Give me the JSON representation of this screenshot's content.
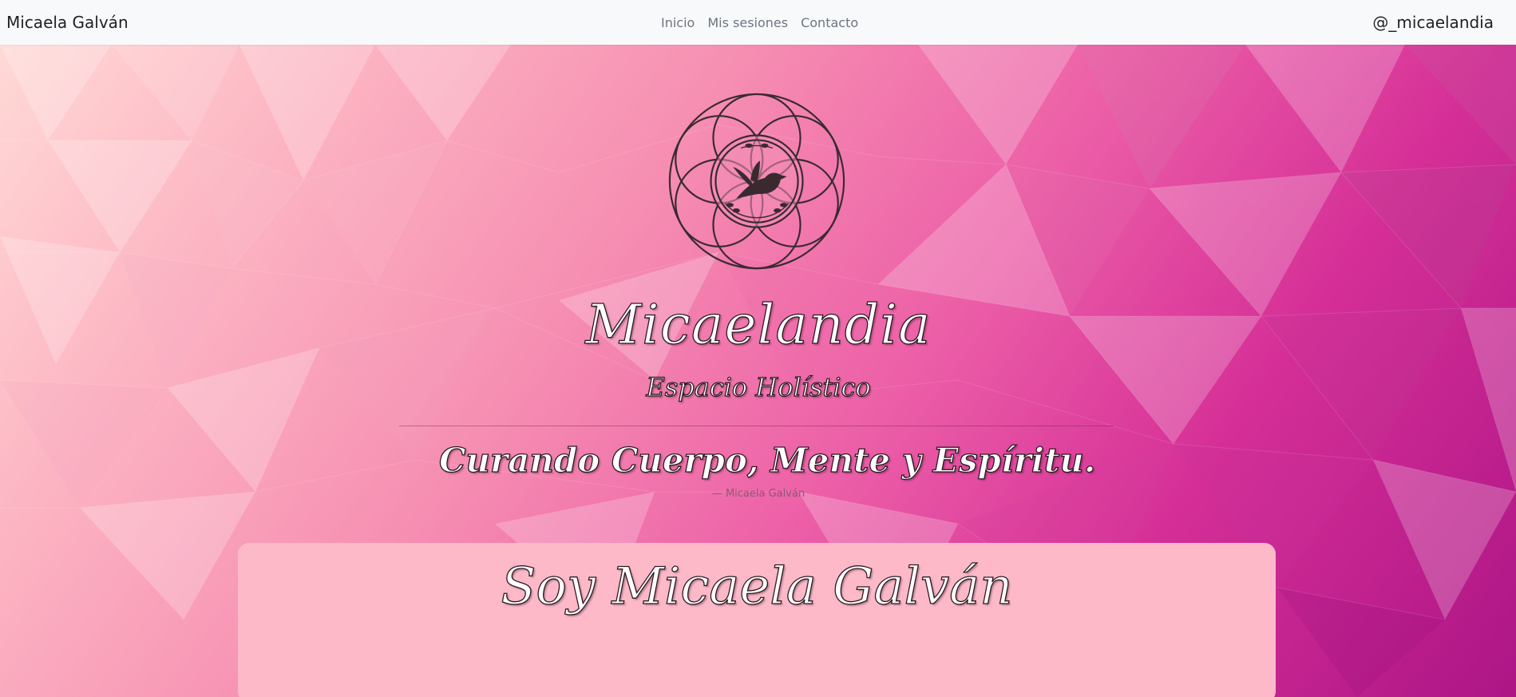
{
  "navbar": {
    "brand": "Micaela Galván",
    "links": [
      "Inicio",
      "Mis sesiones",
      "Contacto"
    ],
    "handle": "@_micaelandia"
  },
  "hero": {
    "title": "Micaelandia",
    "subtitle": "Espacio Holístico",
    "quote": "Curando Cuerpo, Mente y Espíritu.",
    "quote_author": "— Micaela Galván",
    "logo_icon": "flower-of-life-bird-icon"
  },
  "about_card": {
    "title": "Soy Micaela Galván"
  },
  "colors": {
    "gradient_light": "#ffd9d6",
    "gradient_mid": "#ec5ea7",
    "gradient_dark": "#ad1586",
    "card_bg": "#fdb9c8",
    "logo_stroke": "#3a2a30"
  }
}
